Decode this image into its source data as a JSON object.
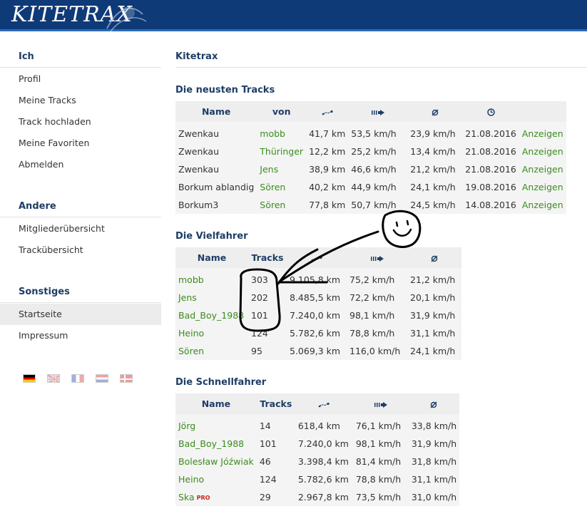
{
  "header": {
    "logo_text": "KITETRAX"
  },
  "sidebar": {
    "sections": [
      {
        "title": "Ich",
        "items": [
          "Profil",
          "Meine Tracks",
          "Track hochladen",
          "Meine Favoriten",
          "Abmelden"
        ]
      },
      {
        "title": "Andere",
        "items": [
          "Mitgliederübersicht",
          "Trackübersicht"
        ]
      },
      {
        "title": "Sonstiges",
        "items": [
          "Startseite",
          "Impressum"
        ],
        "active_item": "Startseite"
      }
    ],
    "flags": [
      "german-flag-icon",
      "uk-flag-icon",
      "french-flag-icon",
      "dutch-flag-icon",
      "danish-flag-icon"
    ]
  },
  "main": {
    "page_title": "Kitetrax",
    "newest": {
      "title": "Die neusten Tracks",
      "headers": {
        "name": "Name",
        "by": "von",
        "distance_icon": "distance-icon",
        "speed_icon": "top-speed-icon",
        "avg_icon": "average-icon",
        "date_icon": "clock-icon"
      },
      "rows": [
        {
          "name": "Zwenkau",
          "by": "mobb",
          "dist": "41,7 km",
          "max": "53,5 km/h",
          "avg": "23,9 km/h",
          "date": "21.08.2016",
          "action": "Anzeigen"
        },
        {
          "name": "Zwenkau",
          "by": "Thüringer",
          "dist": "12,2 km",
          "max": "25,2 km/h",
          "avg": "13,4 km/h",
          "date": "21.08.2016",
          "action": "Anzeigen"
        },
        {
          "name": "Zwenkau",
          "by": "Jens",
          "dist": "38,9 km",
          "max": "46,6 km/h",
          "avg": "21,2 km/h",
          "date": "21.08.2016",
          "action": "Anzeigen"
        },
        {
          "name": "Borkum ablandig",
          "by": "Sören",
          "dist": "40,2 km",
          "max": "44,9 km/h",
          "avg": "24,1 km/h",
          "date": "19.08.2016",
          "action": "Anzeigen"
        },
        {
          "name": "Borkum3",
          "by": "Sören",
          "dist": "77,8 km",
          "max": "50,7 km/h",
          "avg": "24,5 km/h",
          "date": "14.08.2016",
          "action": "Anzeigen"
        }
      ]
    },
    "frequent": {
      "title": "Die Vielfahrer",
      "headers": {
        "name": "Name",
        "tracks": "Tracks"
      },
      "rows": [
        {
          "name": "mobb",
          "tracks": "303",
          "dist": "9.105,8 km",
          "max": "75,2 km/h",
          "avg": "21,2 km/h"
        },
        {
          "name": "Jens",
          "tracks": "202",
          "dist": "8.485,5 km",
          "max": "72,2 km/h",
          "avg": "20,1 km/h"
        },
        {
          "name": "Bad_Boy_1988",
          "tracks": "101",
          "dist": "7.240,0 km",
          "max": "98,1 km/h",
          "avg": "31,9 km/h"
        },
        {
          "name": "Heino",
          "tracks": "124",
          "dist": "5.782,6 km",
          "max": "78,8 km/h",
          "avg": "31,1 km/h"
        },
        {
          "name": "Sören",
          "tracks": "95",
          "dist": "5.069,3 km",
          "max": "116,0 km/h",
          "avg": "24,1 km/h"
        }
      ]
    },
    "fastest": {
      "title": "Die Schnellfahrer",
      "headers": {
        "name": "Name",
        "tracks": "Tracks"
      },
      "rows": [
        {
          "name": "Jörg",
          "tracks": "14",
          "dist": "618,4 km",
          "max": "76,1 km/h",
          "avg": "33,8 km/h",
          "badge": ""
        },
        {
          "name": "Bad_Boy_1988",
          "tracks": "101",
          "dist": "7.240,0 km",
          "max": "98,1 km/h",
          "avg": "31,9 km/h",
          "badge": ""
        },
        {
          "name": "Bolesław Jóźwiak",
          "tracks": "46",
          "dist": "3.398,4 km",
          "max": "81,4 km/h",
          "avg": "31,8 km/h",
          "badge": ""
        },
        {
          "name": "Heino",
          "tracks": "124",
          "dist": "5.782,6 km",
          "max": "78,8 km/h",
          "avg": "31,1 km/h",
          "badge": ""
        },
        {
          "name": "Ska",
          "tracks": "29",
          "dist": "2.967,8 km",
          "max": "73,5 km/h",
          "avg": "31,0 km/h",
          "badge": "PRO"
        }
      ]
    }
  },
  "colors": {
    "header_bg": "#0f3a78",
    "title": "#1f3d66",
    "link_green": "#3c8c1e",
    "pro_badge": "#cc2222"
  }
}
